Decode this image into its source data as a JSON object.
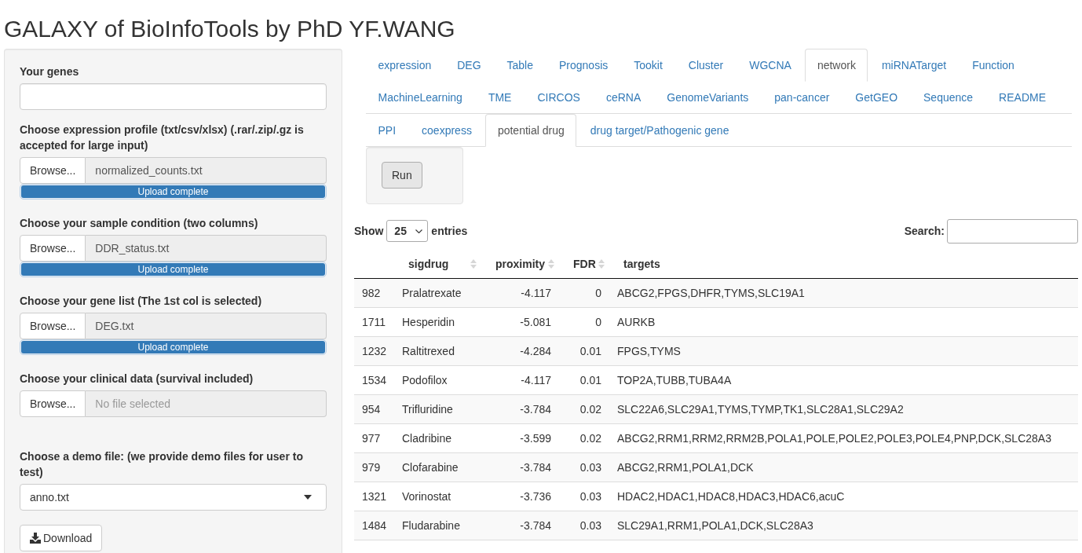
{
  "title": "GALAXY of BioInfoTools by PhD YF.WANG",
  "sidebar": {
    "fields": [
      {
        "kind": "text",
        "label": "Your genes"
      },
      {
        "kind": "file",
        "label": "Choose expression profile (txt/csv/xlsx) (.rar/.zip/.gz is accepted for large input)",
        "button": "Browse...",
        "filename": "normalized_counts.txt",
        "progress": {
          "level": 1,
          "label": "Upload complete"
        }
      },
      {
        "kind": "file",
        "label": "Choose your sample condition (two columns)",
        "button": "Browse...",
        "filename": "DDR_status.txt",
        "progress": {
          "level": 1,
          "label": "Upload complete"
        }
      },
      {
        "kind": "file",
        "label": "Choose your gene list (The 1st col is selected)",
        "button": "Browse...",
        "filename": "DEG.txt",
        "progress": {
          "level": 1,
          "label": "Upload complete"
        }
      },
      {
        "kind": "file",
        "label": "Choose your clinical data (survival included)",
        "button": "Browse...",
        "placeholder": "No file selected"
      },
      {
        "kind": "select",
        "label": "Choose a demo file: (we provide demo files for user to test)",
        "value": "anno.txt"
      }
    ],
    "download_button": "Download"
  },
  "tabs": [
    {
      "label": "expression",
      "selected": false
    },
    {
      "label": "DEG",
      "selected": false
    },
    {
      "label": "Table",
      "selected": false
    },
    {
      "label": "Prognosis",
      "selected": false
    },
    {
      "label": "Tookit",
      "selected": false
    },
    {
      "label": "Cluster",
      "selected": false
    },
    {
      "label": "WGCNA",
      "selected": false
    },
    {
      "label": "network",
      "selected": true
    },
    {
      "label": "miRNATarget",
      "selected": false
    },
    {
      "label": "Function",
      "selected": false
    },
    {
      "label": "MachineLearning",
      "selected": false
    },
    {
      "label": "TME",
      "selected": false
    },
    {
      "label": "CIRCOS",
      "selected": false
    },
    {
      "label": "ceRNA",
      "selected": false
    },
    {
      "label": "GenomeVariants",
      "selected": false
    },
    {
      "label": "pan-cancer",
      "selected": false
    },
    {
      "label": "GetGEO",
      "selected": false
    },
    {
      "label": "Sequence",
      "selected": false
    },
    {
      "label": "README",
      "selected": false
    }
  ],
  "subtabs": [
    {
      "label": "PPI",
      "selected": false
    },
    {
      "label": "coexpress",
      "selected": false
    },
    {
      "label": "potential drug",
      "selected": true
    },
    {
      "label": "drug target/Pathogenic gene",
      "selected": false
    }
  ],
  "run_button": "Run",
  "table": {
    "length": {
      "before": "Show",
      "value": "25",
      "after": "entries"
    },
    "search_label": "Search:",
    "columns": [
      {
        "label": "sigdrug",
        "sortable": true,
        "kind": "text"
      },
      {
        "label": "proximity",
        "sortable": true,
        "kind": "number"
      },
      {
        "label": "FDR",
        "sortable": true,
        "kind": "number"
      },
      {
        "label": "targets",
        "sortable": false,
        "kind": "text"
      }
    ],
    "rows": [
      {
        "number": "982",
        "cells": [
          "Pralatrexate",
          "-4.117",
          "0",
          "ABCG2,FPGS,DHFR,TYMS,SLC19A1"
        ]
      },
      {
        "number": "1711",
        "cells": [
          "Hesperidin",
          "-5.081",
          "0",
          "AURKB"
        ]
      },
      {
        "number": "1232",
        "cells": [
          "Raltitrexed",
          "-4.284",
          "0.01",
          "FPGS,TYMS"
        ]
      },
      {
        "number": "1534",
        "cells": [
          "Podofilox",
          "-4.117",
          "0.01",
          "TOP2A,TUBB,TUBA4A"
        ]
      },
      {
        "number": "954",
        "cells": [
          "Trifluridine",
          "-3.784",
          "0.02",
          "SLC22A6,SLC29A1,TYMS,TYMP,TK1,SLC28A1,SLC29A2"
        ]
      },
      {
        "number": "977",
        "cells": [
          "Cladribine",
          "-3.599",
          "0.02",
          "ABCG2,RRM1,RRM2,RRM2B,POLA1,POLE,POLE2,POLE3,POLE4,PNP,DCK,SLC28A3"
        ]
      },
      {
        "number": "979",
        "cells": [
          "Clofarabine",
          "-3.784",
          "0.03",
          "ABCG2,RRM1,POLA1,DCK"
        ]
      },
      {
        "number": "1321",
        "cells": [
          "Vorinostat",
          "-3.736",
          "0.03",
          "HDAC2,HDAC1,HDAC8,HDAC3,HDAC6,acuC"
        ]
      },
      {
        "number": "1484",
        "cells": [
          "Fludarabine",
          "-3.784",
          "0.03",
          "SLC29A1,RRM1,POLA1,DCK,SLC28A3"
        ]
      }
    ]
  }
}
